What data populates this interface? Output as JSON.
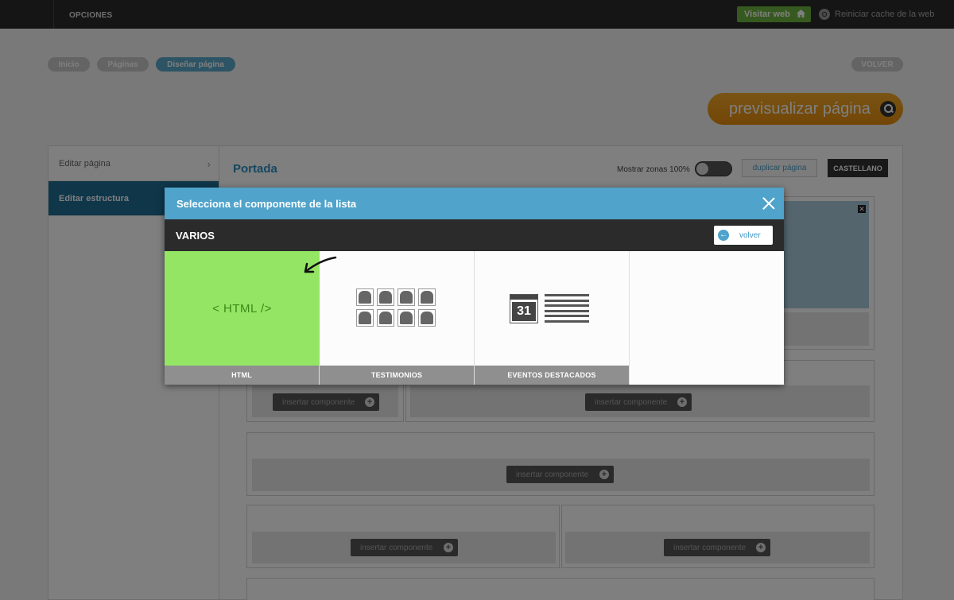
{
  "topbar": {
    "opciones": "OPCIONES",
    "visit_web": "Visitar web",
    "reload": "Reiniciar cache de la web"
  },
  "breadcrumbs": [
    "Inicio",
    "Páginas",
    "Diseñar página"
  ],
  "volver_label": "VOLVER",
  "preview_label": "previsualizar página",
  "sidebar": {
    "items": [
      {
        "label": "Editar página"
      },
      {
        "label": "Editar estructura"
      }
    ]
  },
  "main": {
    "title": "Portada",
    "show_zones_label": "Mostrar zonas 100%",
    "duplicate_label": "duplicar página",
    "language": "CASTELLANO",
    "insert_label": "insertar componente"
  },
  "modal": {
    "title": "Selecciona el componente de la lista",
    "category": "VARIOS",
    "back_label": "volver",
    "html_art": "< HTML />",
    "calendar_day": "31",
    "components": [
      {
        "label": "HTML"
      },
      {
        "label": "TESTIMONIOS"
      },
      {
        "label": "EVENTOS DESTACADOS"
      }
    ]
  },
  "colors": {
    "accent_blue": "#50a3ca",
    "html_green": "#94e563",
    "preview_orange": "#e48b0b",
    "visit_green": "#6db33f"
  }
}
